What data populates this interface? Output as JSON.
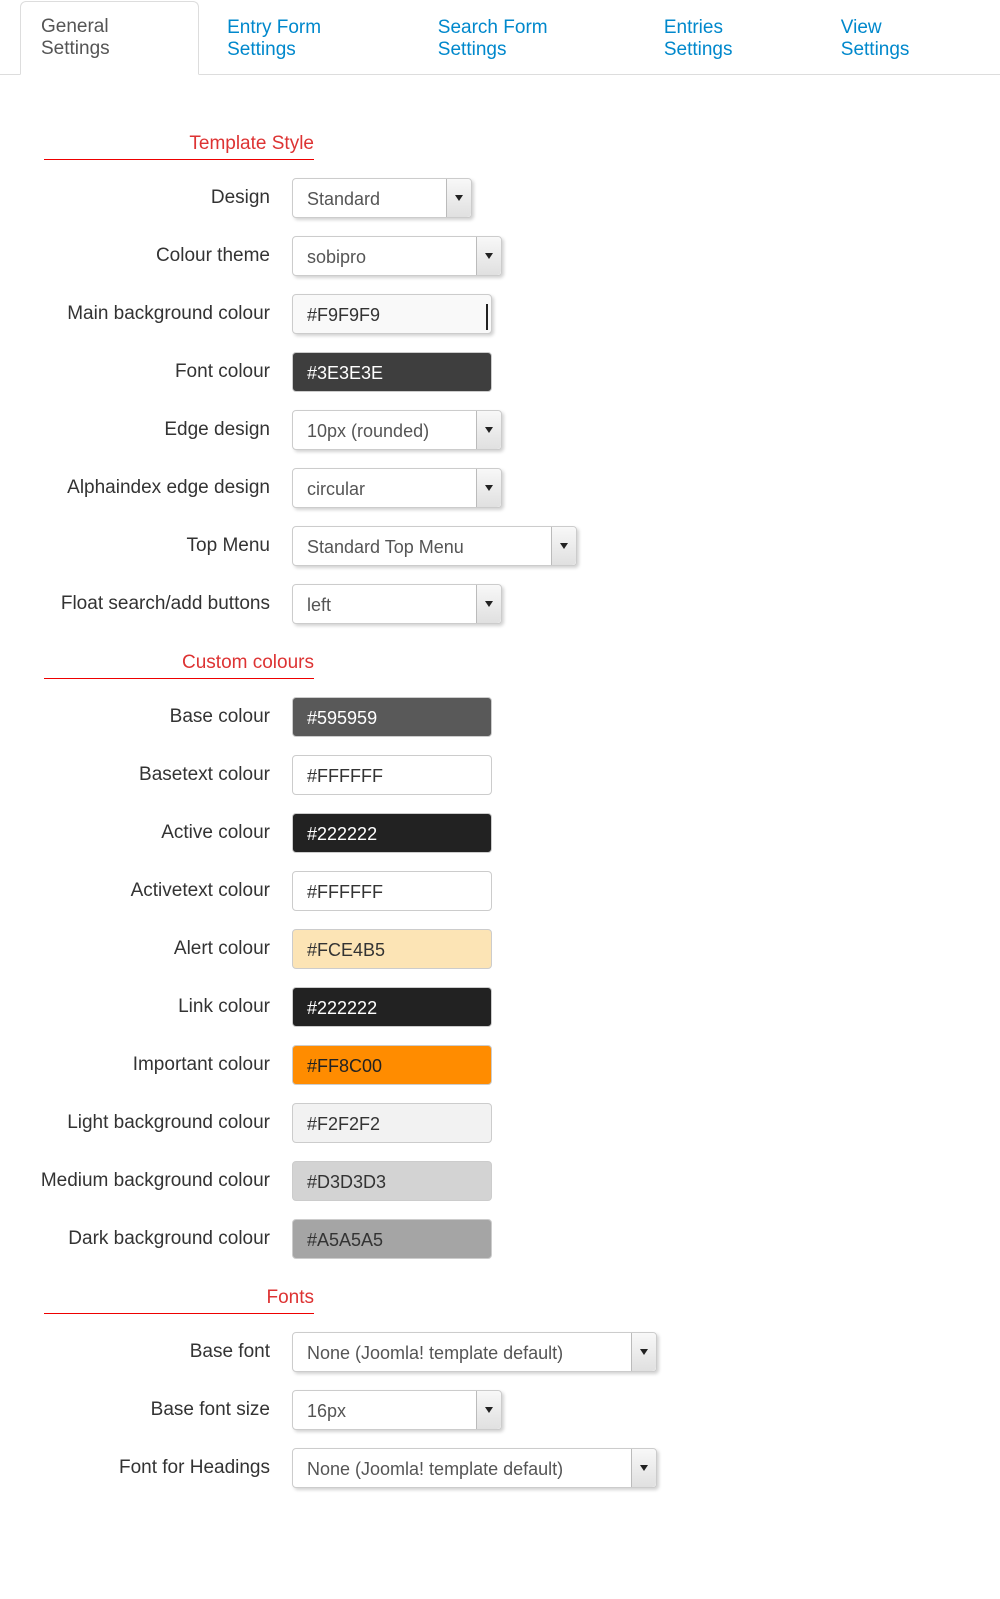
{
  "tabs": {
    "general": "General Settings",
    "entry_form": "Entry Form Settings",
    "search_form": "Search Form Settings",
    "entries": "Entries Settings",
    "view": "View Settings"
  },
  "sections": {
    "template_style": {
      "title": "Template Style",
      "design": {
        "label": "Design",
        "value": "Standard"
      },
      "colour_theme": {
        "label": "Colour theme",
        "value": "sobipro"
      },
      "main_bg": {
        "label": "Main background colour",
        "value": "#F9F9F9",
        "bg": "#F9F9F9",
        "fg": "#333333"
      },
      "font_colour": {
        "label": "Font colour",
        "value": "#3E3E3E",
        "bg": "#3E3E3E",
        "fg": "#FFFFFF"
      },
      "edge_design": {
        "label": "Edge design",
        "value": "10px (rounded)"
      },
      "alpha_edge": {
        "label": "Alphaindex edge design",
        "value": "circular"
      },
      "top_menu": {
        "label": "Top Menu",
        "value": "Standard Top Menu"
      },
      "float_btns": {
        "label": "Float search/add buttons",
        "value": "left"
      }
    },
    "custom_colours": {
      "title": "Custom colours",
      "base": {
        "label": "Base colour",
        "value": "#595959",
        "bg": "#595959",
        "fg": "#FFFFFF"
      },
      "basetext": {
        "label": "Basetext colour",
        "value": "#FFFFFF",
        "bg": "#FFFFFF",
        "fg": "#333333"
      },
      "active": {
        "label": "Active colour",
        "value": "#222222",
        "bg": "#222222",
        "fg": "#FFFFFF"
      },
      "activetext": {
        "label": "Activetext colour",
        "value": "#FFFFFF",
        "bg": "#FFFFFF",
        "fg": "#333333"
      },
      "alert": {
        "label": "Alert colour",
        "value": "#FCE4B5",
        "bg": "#FCE4B5",
        "fg": "#333333"
      },
      "link": {
        "label": "Link colour",
        "value": "#222222",
        "bg": "#222222",
        "fg": "#FFFFFF"
      },
      "important": {
        "label": "Important colour",
        "value": "#FF8C00",
        "bg": "#FF8C00",
        "fg": "#222222"
      },
      "light_bg": {
        "label": "Light background colour",
        "value": "#F2F2F2",
        "bg": "#F2F2F2",
        "fg": "#333333"
      },
      "medium_bg": {
        "label": "Medium background colour",
        "value": "#D3D3D3",
        "bg": "#D3D3D3",
        "fg": "#333333"
      },
      "dark_bg": {
        "label": "Dark background colour",
        "value": "#A5A5A5",
        "bg": "#A5A5A5",
        "fg": "#333333"
      }
    },
    "fonts": {
      "title": "Fonts",
      "base_font": {
        "label": "Base font",
        "value": "None (Joomla! template default)"
      },
      "base_font_size": {
        "label": "Base font size",
        "value": "16px"
      },
      "headings_font": {
        "label": "Font for Headings",
        "value": "None (Joomla! template default)"
      }
    }
  }
}
